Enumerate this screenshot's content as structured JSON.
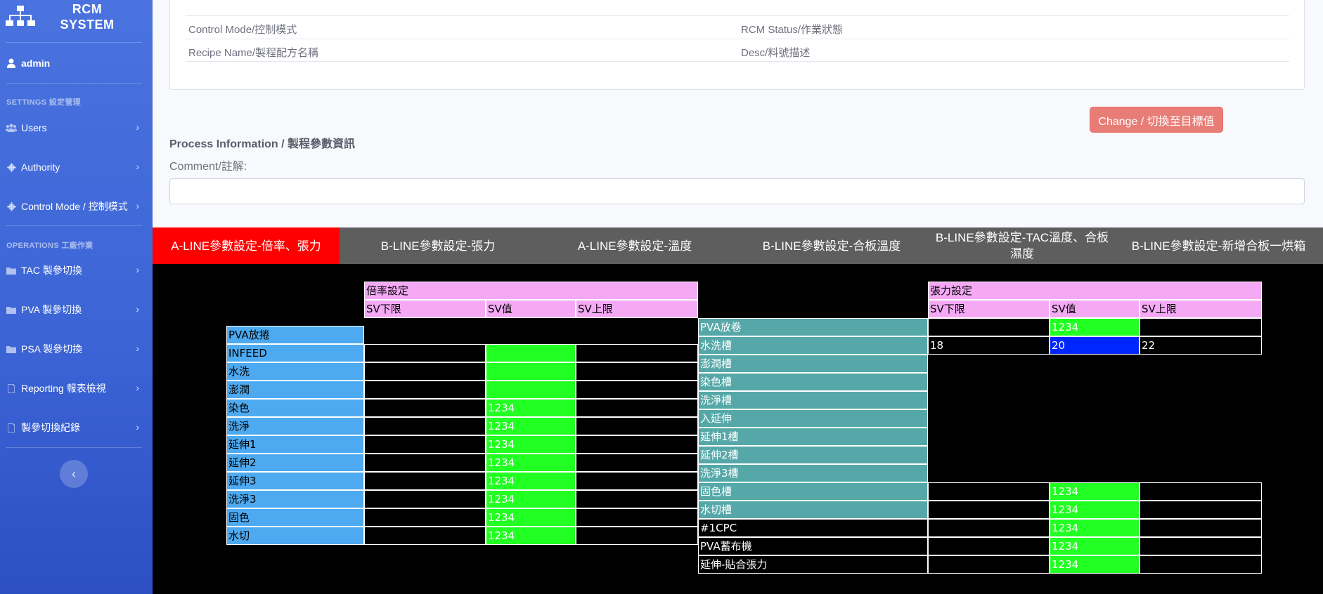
{
  "sidebar": {
    "brand_line1": "RCM",
    "brand_line2": "SYSTEM",
    "user": "admin",
    "section_settings": "SETTINGS 設定管理",
    "section_operations": "OPERATIONS 工廠作業",
    "items": [
      {
        "label": "Users",
        "icon": "users-icon"
      },
      {
        "label": "Authority",
        "icon": "gear-icon"
      },
      {
        "label": "Control Mode / 控制模式",
        "icon": "gear-icon"
      },
      {
        "label": "TAC 製參切換",
        "icon": "folder-icon"
      },
      {
        "label": "PVA 製參切換",
        "icon": "folder-icon"
      },
      {
        "label": "PSA 製參切換",
        "icon": "folder-icon"
      },
      {
        "label": "Reporting 報表檢視",
        "icon": "file-icon"
      },
      {
        "label": "製參切換紀錄",
        "icon": "file-icon"
      }
    ],
    "toggle": "‹"
  },
  "info": {
    "control_mode": "Control Mode/控制模式",
    "rcm_status": "RCM Status/作業狀態",
    "recipe_name": "Recipe Name/製程配方名稱",
    "desc": "Desc/料號描述"
  },
  "change_button": "Change / 切換至目標值",
  "process_title": "Process Information / 製程參數資訊",
  "comment_label": "Comment/註解:",
  "comment_value": "",
  "tabs": [
    "A-LINE參數設定-倍率、張力",
    "B-LINE參數設定-張力",
    "A-LINE參數設定-溫度",
    "B-LINE參數設定-合板溫度",
    "B-LINE參數設定-TAC溫度、合板\n濕度",
    "B-LINE參數設定-新增合板一烘箱"
  ],
  "active_tab": 0,
  "ratio_table": {
    "title": "倍率設定",
    "headers": [
      "SV下限",
      "SV值",
      "SV上限"
    ],
    "rows": [
      {
        "name": "PVA放捲",
        "low": "",
        "sv": "",
        "high": ""
      },
      {
        "name": "INFEED",
        "low": "",
        "sv": "",
        "high": ""
      },
      {
        "name": "水洗",
        "low": "",
        "sv": "",
        "high": ""
      },
      {
        "name": "澎潤",
        "low": "",
        "sv": "",
        "high": ""
      },
      {
        "name": "染色",
        "low": "",
        "sv": "1234",
        "high": ""
      },
      {
        "name": "洗淨",
        "low": "",
        "sv": "1234",
        "high": ""
      },
      {
        "name": "延伸1",
        "low": "",
        "sv": "1234",
        "high": ""
      },
      {
        "name": "延伸2",
        "low": "",
        "sv": "1234",
        "high": ""
      },
      {
        "name": "延伸3",
        "low": "",
        "sv": "1234",
        "high": ""
      },
      {
        "name": "洗淨3",
        "low": "",
        "sv": "1234",
        "high": ""
      },
      {
        "name": "固色",
        "low": "",
        "sv": "1234",
        "high": ""
      },
      {
        "name": "水切",
        "low": "",
        "sv": "1234",
        "high": ""
      }
    ]
  },
  "tension_table": {
    "title": "張力設定",
    "headers": [
      "SV下限",
      "SV值",
      "SV上限"
    ],
    "rows": [
      {
        "name": "PVA放卷",
        "low": "",
        "sv": "1234",
        "high": ""
      },
      {
        "name": "水洗槽",
        "low": "18",
        "sv": "20",
        "high": "22"
      },
      {
        "name": "澎潤槽",
        "low": "",
        "sv": "",
        "high": ""
      },
      {
        "name": "染色槽",
        "low": "",
        "sv": "",
        "high": ""
      },
      {
        "name": "洗淨槽",
        "low": "",
        "sv": "",
        "high": ""
      },
      {
        "name": "入延伸",
        "low": "",
        "sv": "",
        "high": ""
      },
      {
        "name": "延伸1槽",
        "low": "",
        "sv": "",
        "high": ""
      },
      {
        "name": "延伸2槽",
        "low": "",
        "sv": "",
        "high": ""
      },
      {
        "name": "洗淨3槽",
        "low": "",
        "sv": "",
        "high": ""
      },
      {
        "name": "固色槽",
        "low": "",
        "sv": "1234",
        "high": ""
      },
      {
        "name": "水切槽",
        "low": "",
        "sv": "1234",
        "high": ""
      },
      {
        "name": "#1CPC",
        "low": "",
        "sv": "1234",
        "high": ""
      },
      {
        "name": "PVA蓄布機",
        "low": "",
        "sv": "1234",
        "high": ""
      },
      {
        "name": "延伸-貼合張力",
        "low": "",
        "sv": "1234",
        "high": ""
      }
    ]
  },
  "colors": {
    "sidebar": "#4a73df",
    "active_tab": "#ff0000",
    "tab_bar": "#5e5e5e",
    "header_pink": "#f5a9f5",
    "name_blue": "#4eaaf0",
    "name_teal": "#56a8a8",
    "value_green": "#22ff22",
    "value_selected": "#0026ff",
    "change_button": "#e87c76"
  }
}
